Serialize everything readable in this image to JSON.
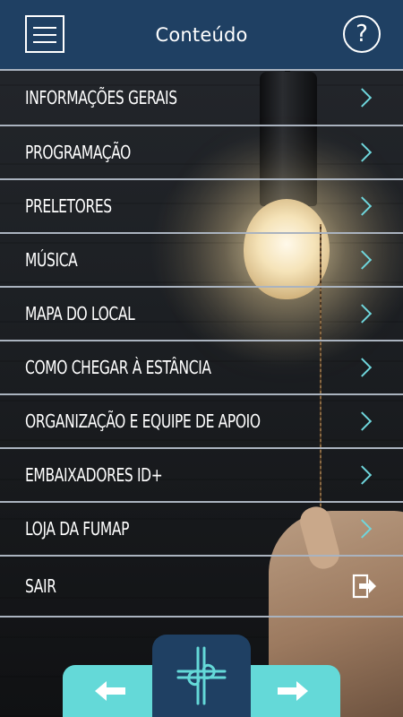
{
  "header": {
    "title": "Conteúdo",
    "help_label": "?"
  },
  "menu": {
    "items": [
      {
        "label": "INFORMAÇÕES GERAIS",
        "icon": "chevron-right-icon"
      },
      {
        "label": "PROGRAMAÇÃO",
        "icon": "chevron-right-icon"
      },
      {
        "label": "PRELETORES",
        "icon": "chevron-right-icon"
      },
      {
        "label": "MÚSICA",
        "icon": "chevron-right-icon"
      },
      {
        "label": "MAPA DO LOCAL",
        "icon": "chevron-right-icon"
      },
      {
        "label": "COMO CHEGAR À ESTÂNCIA",
        "icon": "chevron-right-icon"
      },
      {
        "label": "ORGANIZAÇÃO E EQUIPE DE APOIO",
        "icon": "chevron-right-icon"
      },
      {
        "label": "EMBAIXADORES ID+",
        "icon": "chevron-right-icon"
      },
      {
        "label": "LOJA DA FUMAP",
        "icon": "chevron-right-icon"
      },
      {
        "label": "SAIR",
        "icon": "exit-icon"
      }
    ]
  },
  "colors": {
    "header_bg": "#1f4063",
    "accent": "#64d9d8",
    "chevron": "#6fd6dc",
    "divider": "#aab3bf"
  },
  "bottom_nav": {
    "left_icon": "arrow-left-icon",
    "center_icon": "cross-logo-icon",
    "right_icon": "arrow-right-icon"
  }
}
